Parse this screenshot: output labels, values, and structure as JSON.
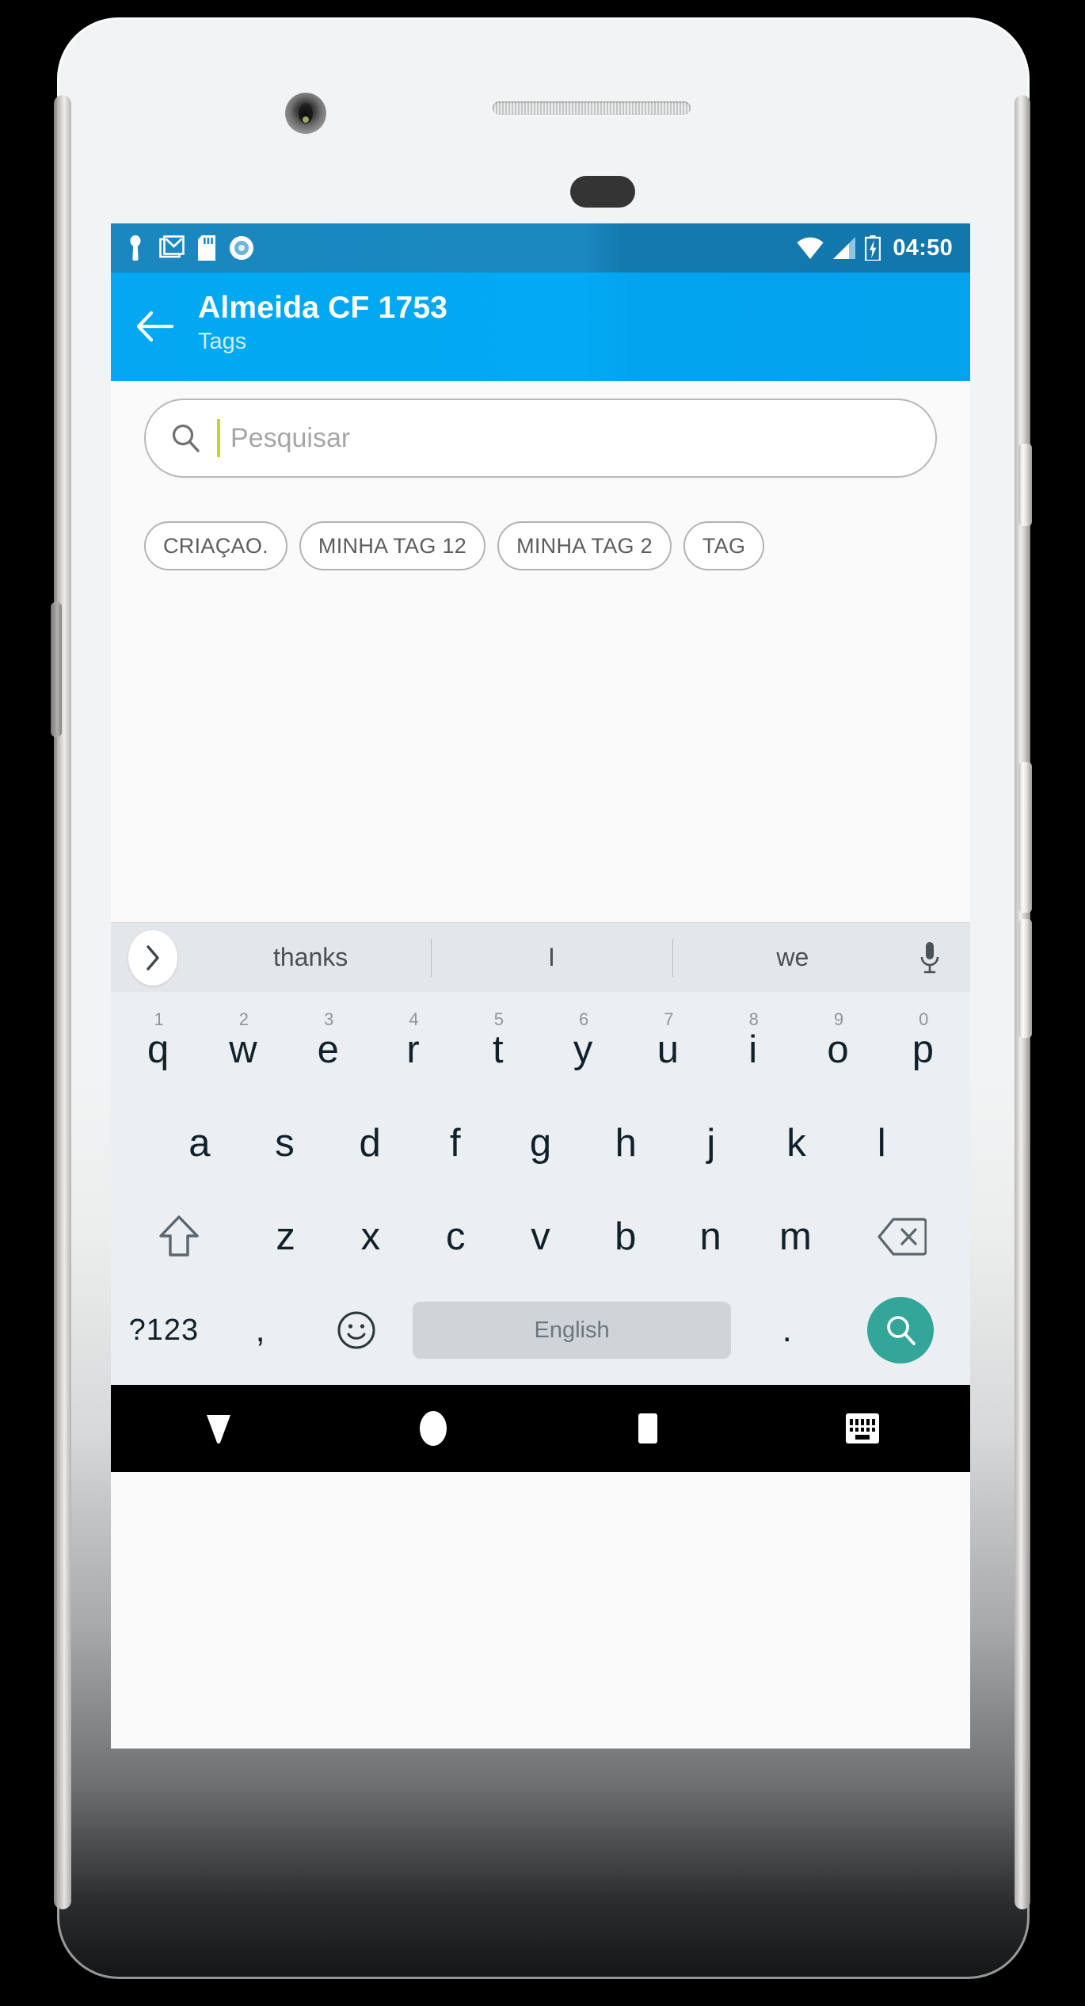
{
  "statusbar": {
    "time": "04:50",
    "left_icons": [
      "person-pin-icon",
      "gmail-icon",
      "sd-card-icon",
      "disc-icon"
    ],
    "right_icons": [
      "wifi-icon",
      "signal-icon",
      "battery-charging-icon"
    ],
    "bg_color": "#1b88c0"
  },
  "appbar": {
    "back_icon": "arrow-back-icon",
    "title": "Almeida CF 1753",
    "subtitle": "Tags",
    "bg_color": "#03a9f4",
    "subtitle_color": "#cdeffd"
  },
  "search": {
    "icon": "search-icon",
    "placeholder": "Pesquisar",
    "value": "",
    "caret_color": "#c4d62b"
  },
  "tags": {
    "chips": [
      {
        "label": "CRIAÇAO."
      },
      {
        "label": "MINHA TAG 12"
      },
      {
        "label": "MINHA TAG 2"
      },
      {
        "label": "TAG"
      }
    ]
  },
  "keyboard": {
    "bg_color": "#eceff1",
    "suggestion_bar": {
      "expand_icon": "chevron-right-icon",
      "suggestions": [
        "thanks",
        "I",
        "we"
      ],
      "mic_icon": "microphone-icon"
    },
    "row1": [
      {
        "key": "q",
        "num": "1"
      },
      {
        "key": "w",
        "num": "2"
      },
      {
        "key": "e",
        "num": "3"
      },
      {
        "key": "r",
        "num": "4"
      },
      {
        "key": "t",
        "num": "5"
      },
      {
        "key": "y",
        "num": "6"
      },
      {
        "key": "u",
        "num": "7"
      },
      {
        "key": "i",
        "num": "8"
      },
      {
        "key": "o",
        "num": "9"
      },
      {
        "key": "p",
        "num": "0"
      }
    ],
    "row2": [
      {
        "key": "a"
      },
      {
        "key": "s"
      },
      {
        "key": "d"
      },
      {
        "key": "f"
      },
      {
        "key": "g"
      },
      {
        "key": "h"
      },
      {
        "key": "j"
      },
      {
        "key": "k"
      },
      {
        "key": "l"
      }
    ],
    "row3": {
      "shift_icon": "shift-icon",
      "keys": [
        {
          "key": "z"
        },
        {
          "key": "x"
        },
        {
          "key": "c"
        },
        {
          "key": "v"
        },
        {
          "key": "b"
        },
        {
          "key": "n"
        },
        {
          "key": "m"
        }
      ],
      "backspace_icon": "backspace-icon"
    },
    "row4": {
      "symbols_label": "?123",
      "comma_label": ",",
      "emoji_icon": "emoji-icon",
      "space_label": "English",
      "period_label": ".",
      "enter_icon": "search-icon",
      "enter_color": "#34a699"
    }
  },
  "navbar": {
    "buttons": [
      {
        "icon": "keyboard-down-icon"
      },
      {
        "icon": "home-circle-icon"
      },
      {
        "icon": "recents-square-icon"
      },
      {
        "icon": "change-keyboard-icon"
      }
    ],
    "bg_color": "#000000"
  }
}
